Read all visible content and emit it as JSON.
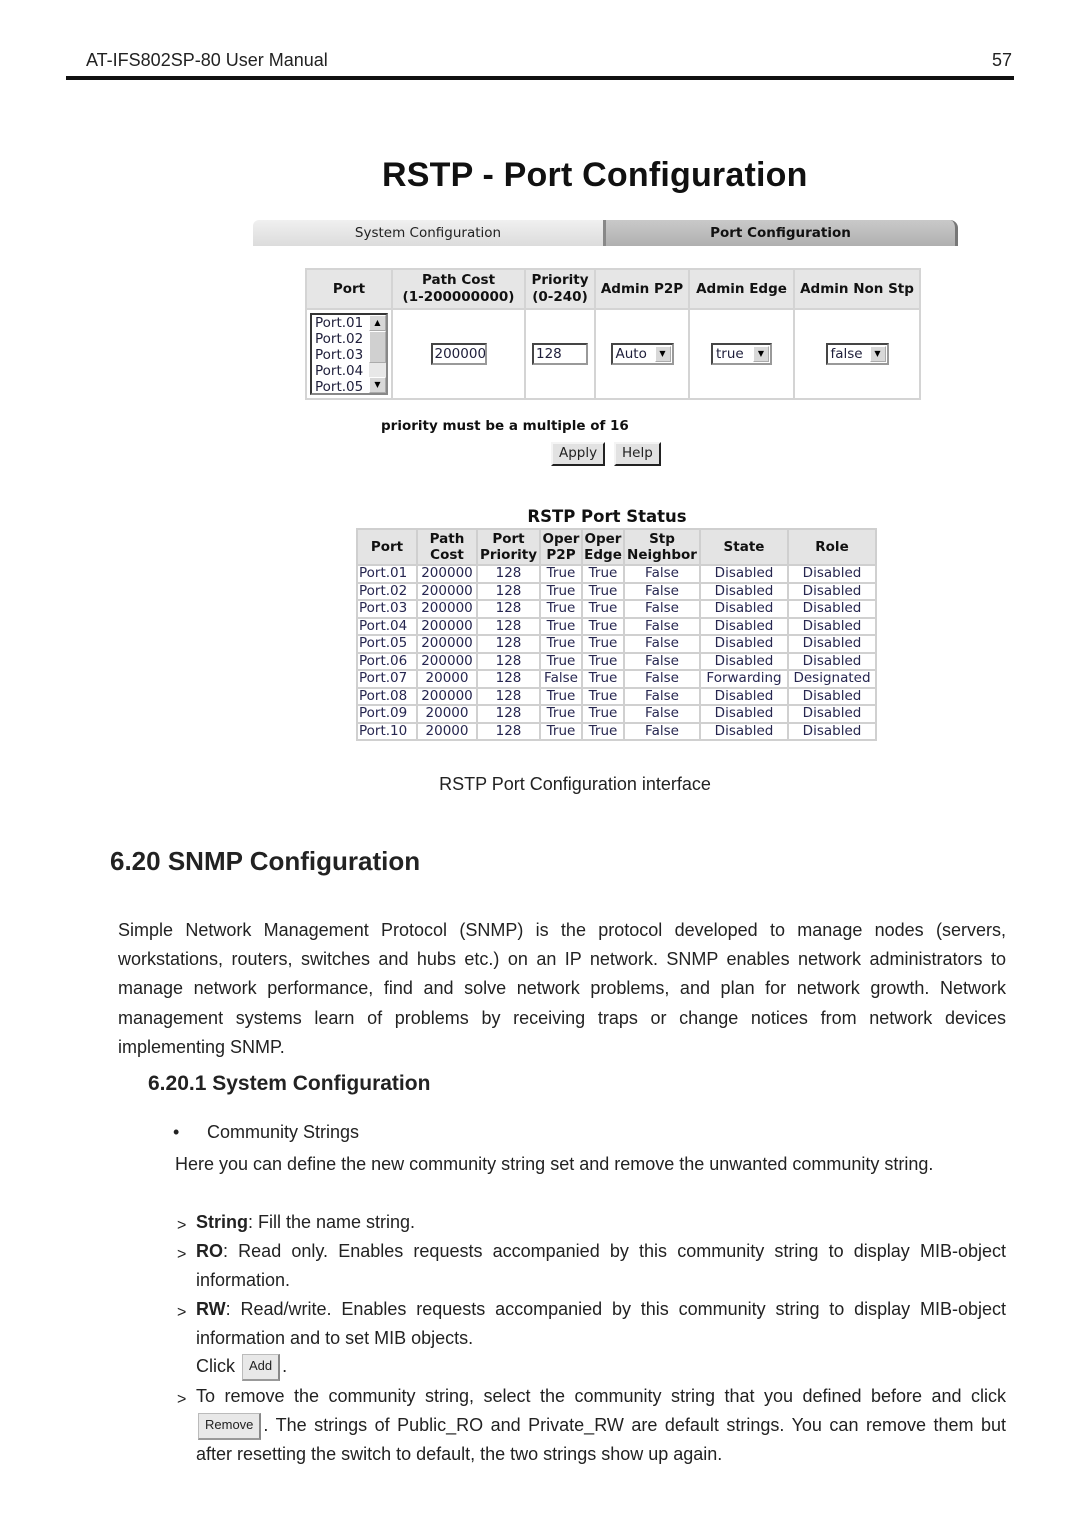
{
  "header": {
    "title": "AT-IFS802SP-80 User Manual",
    "page_number": "57"
  },
  "screenshot": {
    "title": "RSTP - Port Configuration",
    "tabs": [
      {
        "label": "System Configuration",
        "active": false
      },
      {
        "label": "Port Configuration",
        "active": true
      }
    ],
    "config_table": {
      "headers": [
        {
          "line1": "Port",
          "line2": ""
        },
        {
          "line1": "Path Cost",
          "line2": "(1-200000000)"
        },
        {
          "line1": "Priority",
          "line2": "(0-240)"
        },
        {
          "line1": "Admin P2P",
          "line2": ""
        },
        {
          "line1": "Admin Edge",
          "line2": ""
        },
        {
          "line1": "Admin Non Stp",
          "line2": ""
        }
      ],
      "port_list": [
        "Port.01",
        "Port.02",
        "Port.03",
        "Port.04",
        "Port.05"
      ],
      "path_cost_value": "200000",
      "priority_value": "128",
      "admin_p2p_value": "Auto",
      "admin_edge_value": "true",
      "admin_non_stp_value": "false"
    },
    "note": "priority must be a multiple of 16",
    "buttons": {
      "apply": "Apply",
      "help": "Help"
    },
    "status": {
      "title": "RSTP Port Status",
      "headers": [
        {
          "line1": "Port",
          "line2": ""
        },
        {
          "line1": "Path",
          "line2": "Cost"
        },
        {
          "line1": "Port",
          "line2": "Priority"
        },
        {
          "line1": "Oper",
          "line2": "P2P"
        },
        {
          "line1": "Oper",
          "line2": "Edge"
        },
        {
          "line1": "Stp",
          "line2": "Neighbor"
        },
        {
          "line1": "State",
          "line2": ""
        },
        {
          "line1": "Role",
          "line2": ""
        }
      ],
      "rows": [
        [
          "Port.01",
          "200000",
          "128",
          "True",
          "True",
          "False",
          "Disabled",
          "Disabled"
        ],
        [
          "Port.02",
          "200000",
          "128",
          "True",
          "True",
          "False",
          "Disabled",
          "Disabled"
        ],
        [
          "Port.03",
          "200000",
          "128",
          "True",
          "True",
          "False",
          "Disabled",
          "Disabled"
        ],
        [
          "Port.04",
          "200000",
          "128",
          "True",
          "True",
          "False",
          "Disabled",
          "Disabled"
        ],
        [
          "Port.05",
          "200000",
          "128",
          "True",
          "True",
          "False",
          "Disabled",
          "Disabled"
        ],
        [
          "Port.06",
          "200000",
          "128",
          "True",
          "True",
          "False",
          "Disabled",
          "Disabled"
        ],
        [
          "Port.07",
          "20000",
          "128",
          "False",
          "True",
          "False",
          "Forwarding",
          "Designated"
        ],
        [
          "Port.08",
          "200000",
          "128",
          "True",
          "True",
          "False",
          "Disabled",
          "Disabled"
        ],
        [
          "Port.09",
          "20000",
          "128",
          "True",
          "True",
          "False",
          "Disabled",
          "Disabled"
        ],
        [
          "Port.10",
          "20000",
          "128",
          "True",
          "True",
          "False",
          "Disabled",
          "Disabled"
        ]
      ]
    }
  },
  "caption": "RSTP Port Configuration interface",
  "section": {
    "heading": "6.20  SNMP Configuration",
    "paragraph": "Simple Network Management Protocol (SNMP) is the protocol developed to manage nodes (servers, workstations, routers, switches and hubs etc.) on an IP network. SNMP enables network administrators to manage network performance, find and solve network problems, and plan for network growth. Network management systems learn of problems by receiving traps or change notices from network devices implementing SNMP.",
    "subsection": {
      "heading": "6.20.1  System Configuration",
      "bullet": "Community Strings",
      "intro": "Here you can define the new community string set and remove the unwanted community string.",
      "items": [
        {
          "term": "String",
          "text": ": Fill the name string."
        },
        {
          "term": "RO",
          "text": ": Read only. Enables requests accompanied by this community string to display MIB-object information."
        },
        {
          "term": "RW",
          "text": ": Read/write. Enables requests accompanied by this community string to display MIB-object information and to set MIB objects."
        }
      ],
      "click_prefix": "Click",
      "add_button": "Add",
      "click_suffix": ".",
      "remove_text_before": "To remove the community string, select the community string that you defined before and click",
      "remove_button": "Remove",
      "remove_text_after": ". The strings of Public_RO and Private_RW are default strings. You can remove them but after resetting the switch to default, the two strings show up again."
    }
  }
}
